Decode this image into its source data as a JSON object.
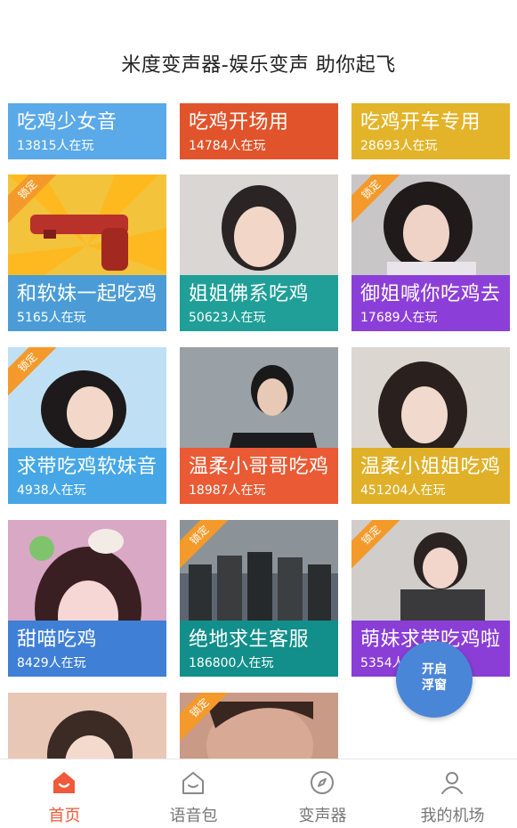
{
  "header": {
    "title": "米度变声器-娱乐变声 助你起飞"
  },
  "cards": [
    {
      "name": "吃鸡少女音",
      "count": "13815人在玩",
      "locked": false,
      "band_color": "#5aa9e8",
      "photo_color": "#7ec3ef"
    },
    {
      "name": "吃鸡开场用",
      "count": "14784人在玩",
      "locked": false,
      "band_color": "#e1542b",
      "photo_color": "#d64a24"
    },
    {
      "name": "吃鸡开车专用",
      "count": "28693人在玩",
      "locked": false,
      "band_color": "#e3b42a",
      "photo_color": "#e8bf3a"
    },
    {
      "name": "和软妹一起吃鸡",
      "count": "5165人在玩",
      "locked": true,
      "lock_label": "锁定",
      "band_color": "#4b9cd6",
      "photo_color": "#f3c33c"
    },
    {
      "name": "姐姐佛系吃鸡",
      "count": "50623人在玩",
      "locked": false,
      "band_color": "#1f9f98",
      "photo_color": "#d9d6d3"
    },
    {
      "name": "御姐喊你吃鸡去",
      "count": "17689人在玩",
      "locked": true,
      "lock_label": "锁定",
      "band_color": "#8c3fd8",
      "photo_color": "#c9c6c8"
    },
    {
      "name": "求带吃鸡软妹音",
      "count": "4938人在玩",
      "locked": true,
      "lock_label": "锁定",
      "band_color": "#47a7e6",
      "photo_color": "#bfe0f4"
    },
    {
      "name": "温柔小哥哥吃鸡",
      "count": "18987人在玩",
      "locked": false,
      "band_color": "#ea5a34",
      "photo_color": "#8d8e90"
    },
    {
      "name": "温柔小姐姐吃鸡",
      "count": "451204人在玩",
      "locked": false,
      "band_color": "#e0b028",
      "photo_color": "#dcd6d1"
    },
    {
      "name": "甜喵吃鸡",
      "count": "8429人在玩",
      "locked": false,
      "band_color": "#3f7fd6",
      "photo_color": "#d9a8c4"
    },
    {
      "name": "绝地求生客服",
      "count": "186800人在玩",
      "locked": true,
      "lock_label": "锁定",
      "band_color": "#128f8a",
      "photo_color": "#5d6670"
    },
    {
      "name": "萌妹求带吃鸡啦",
      "count": "5354人在玩",
      "locked": true,
      "lock_label": "锁定",
      "band_color": "#8a3ed6",
      "photo_color": "#d0cdcb"
    },
    {
      "name": "",
      "count": "",
      "locked": false,
      "band_color": "",
      "photo_color": "#e8c7b6"
    },
    {
      "name": "",
      "count": "",
      "locked": true,
      "lock_label": "锁定",
      "band_color": "",
      "photo_color": "#c99a86"
    }
  ],
  "float_button": {
    "line1": "开启",
    "line2": "浮窗"
  },
  "tabs": [
    {
      "label": "首页",
      "icon": "home-icon",
      "active": true
    },
    {
      "label": "语音包",
      "icon": "voice-pack-icon",
      "active": false
    },
    {
      "label": "变声器",
      "icon": "compass-icon",
      "active": false
    },
    {
      "label": "我的机场",
      "icon": "user-icon",
      "active": false
    }
  ],
  "colors": {
    "accent": "#f1593a",
    "inactive": "#777777",
    "lock": "#f49a2a",
    "float": "#4a86d8"
  }
}
